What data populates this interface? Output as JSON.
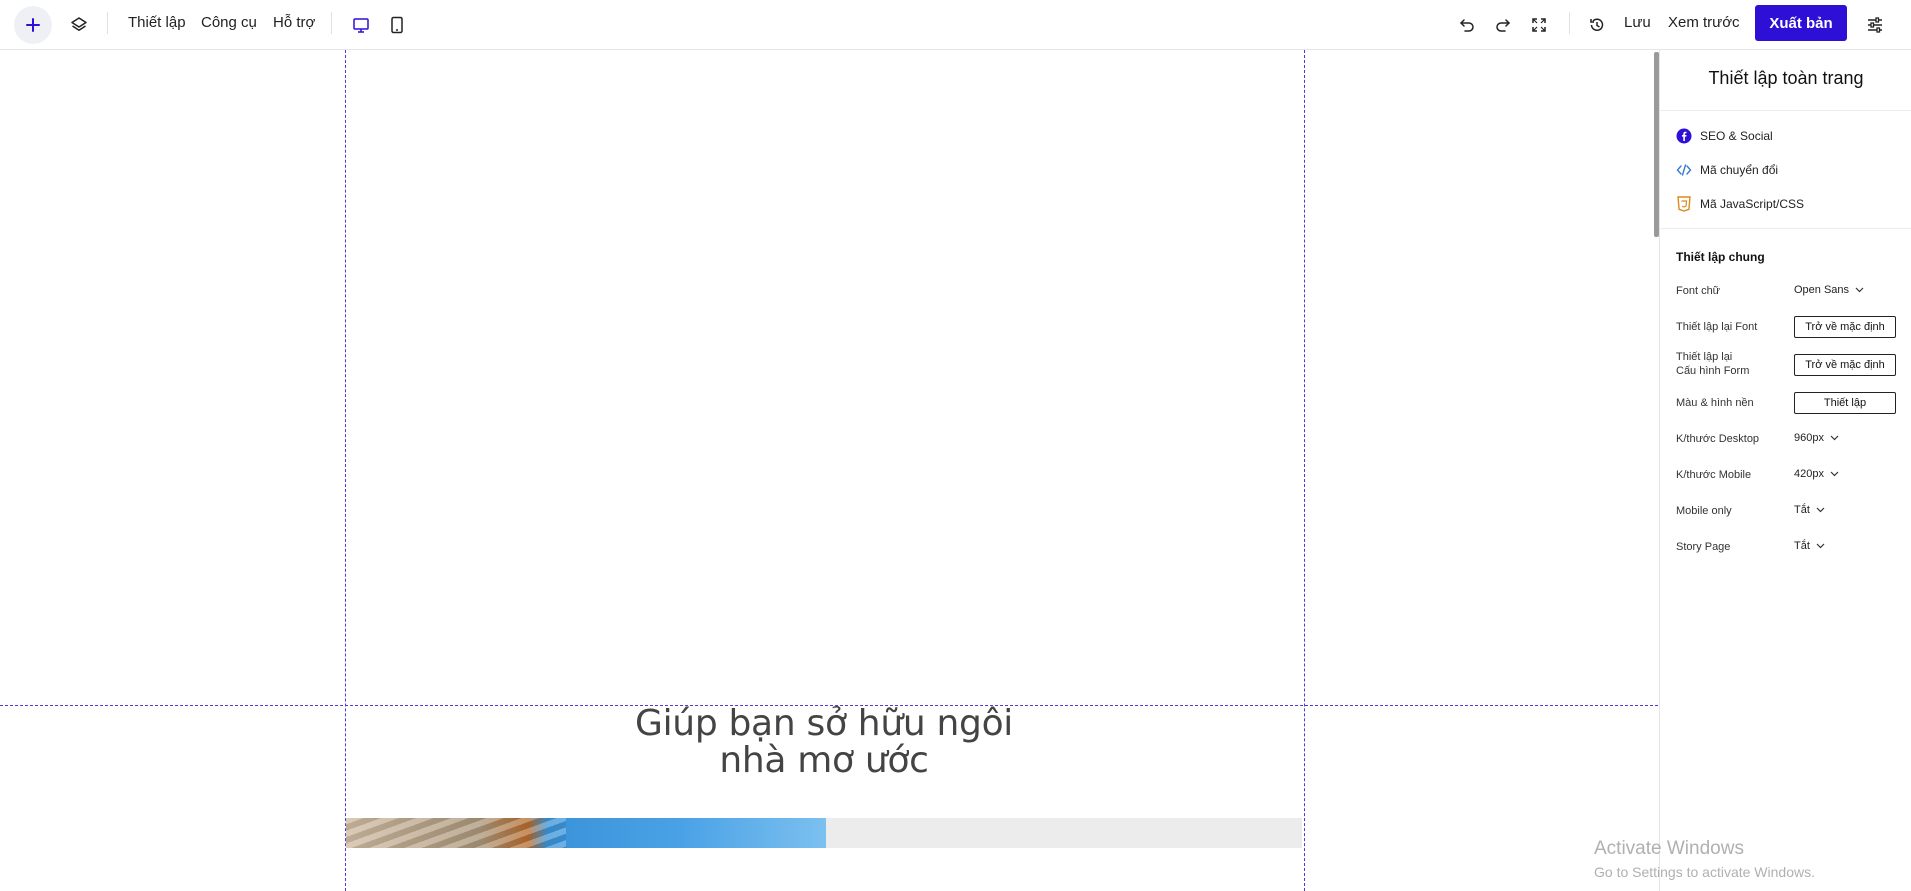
{
  "toolbar": {
    "menu_settings": "Thiết lập",
    "menu_tools": "Công cụ",
    "menu_support": "Hỗ trợ",
    "save": "Lưu",
    "preview": "Xem trước",
    "publish": "Xuất bản",
    "accent_color": "#2d0fd6"
  },
  "canvas": {
    "hero_title_line1": "Giúp bạn sở hữu ngôi",
    "hero_title_line2": "nhà mơ ước"
  },
  "panel": {
    "title": "Thiết lập toàn trang",
    "links": [
      {
        "label": "SEO & Social",
        "icon": "facebook-icon"
      },
      {
        "label": "Mã chuyển đổi",
        "icon": "code-icon"
      },
      {
        "label": "Mã JavaScript/CSS",
        "icon": "html5-icon"
      }
    ],
    "general_title": "Thiết lập chung",
    "font_label": "Font chữ",
    "font_value": "Open Sans",
    "reset_font_label": "Thiết lập lại Font",
    "reset_font_button": "Trở về mặc định",
    "reset_form_label_1": "Thiết lập lại",
    "reset_form_label_2": "Cấu hình Form",
    "reset_form_button": "Trở về mặc định",
    "bg_label": "Màu & hình nền",
    "bg_button": "Thiết lập",
    "desktop_label": "K/thước Desktop",
    "desktop_value": "960px",
    "mobile_label": "K/thước Mobile",
    "mobile_value": "420px",
    "mobile_only_label": "Mobile only",
    "mobile_only_value": "Tắt",
    "story_label": "Story Page",
    "story_value": "Tắt"
  },
  "watermark": {
    "line1": "Activate Windows",
    "line2": "Go to Settings to activate Windows."
  }
}
